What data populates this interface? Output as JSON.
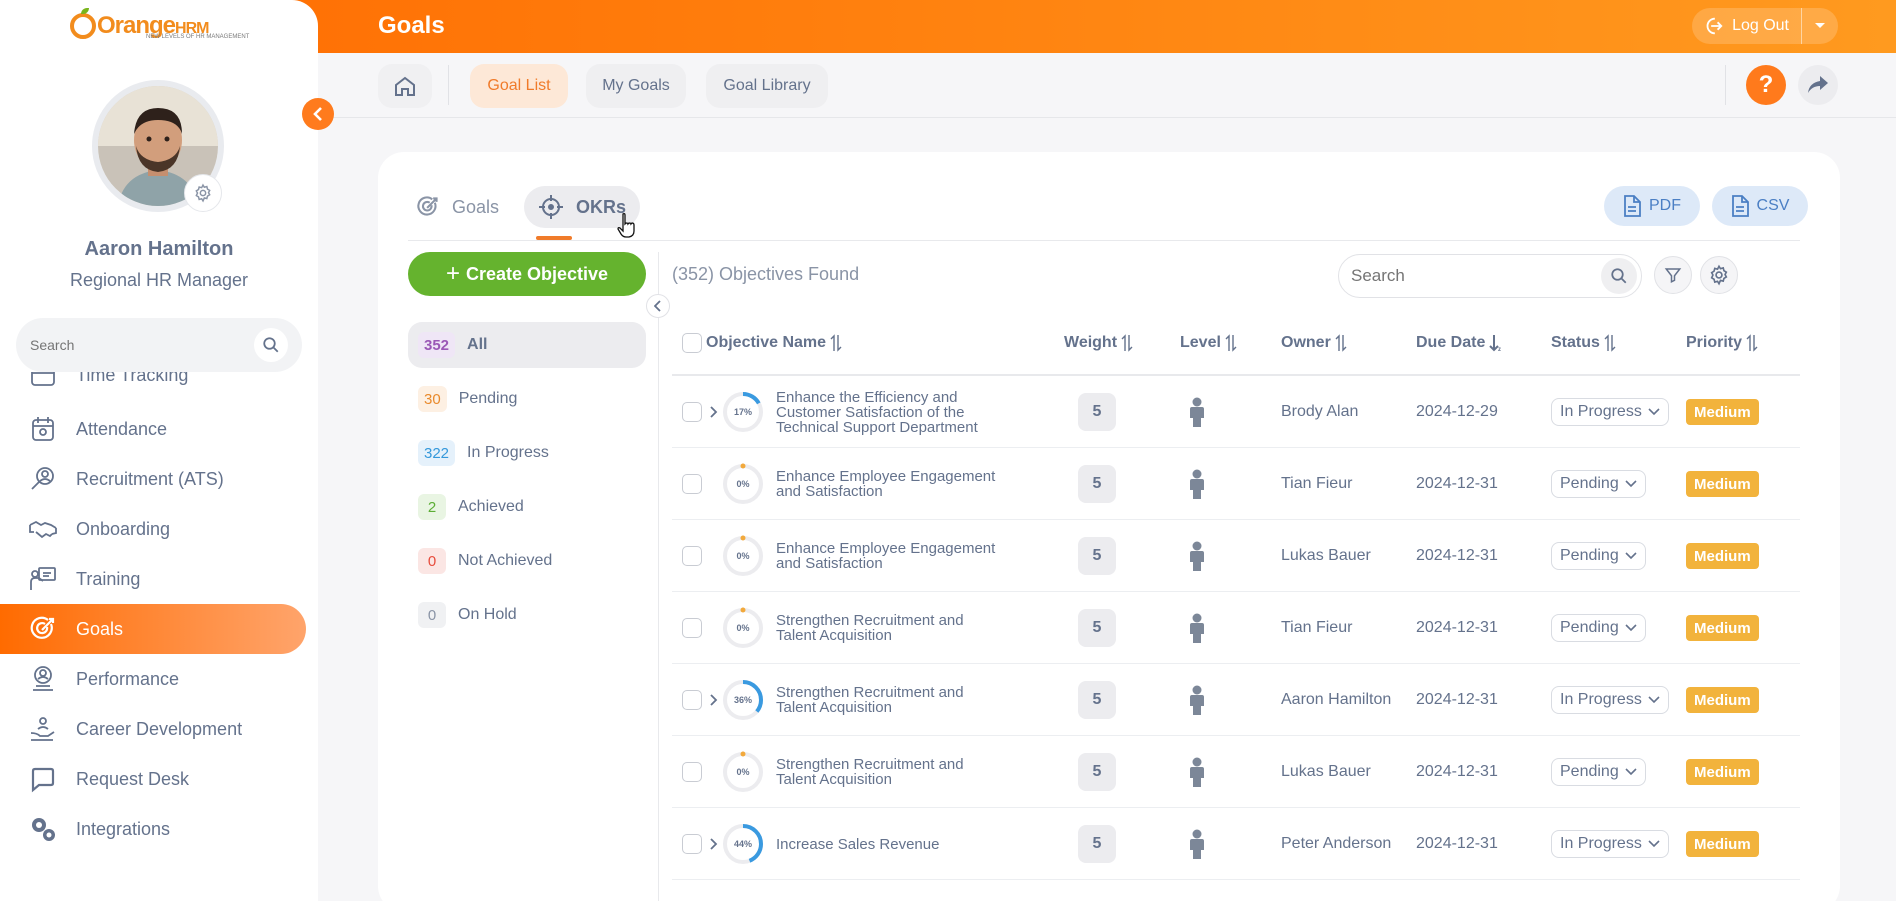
{
  "header": {
    "module_title": "Goals",
    "logout_label": "Log Out",
    "brand_color": "#ff7a1c"
  },
  "brand": {
    "logo_text": "Orange",
    "logo_text_suffix": "HRM",
    "tagline": "NEW LEVELS OF HR MANAGEMENT"
  },
  "user": {
    "name": "Aaron Hamilton",
    "role": "Regional HR Manager"
  },
  "sidebar": {
    "search_placeholder": "Search",
    "items": [
      {
        "label": "Time Tracking",
        "icon": "time-tracking-icon"
      },
      {
        "label": "Attendance",
        "icon": "attendance-icon"
      },
      {
        "label": "Recruitment (ATS)",
        "icon": "recruitment-icon"
      },
      {
        "label": "Onboarding",
        "icon": "onboarding-icon"
      },
      {
        "label": "Training",
        "icon": "training-icon"
      },
      {
        "label": "Goals",
        "icon": "goals-icon",
        "active": true
      },
      {
        "label": "Performance",
        "icon": "performance-icon"
      },
      {
        "label": "Career Development",
        "icon": "career-development-icon"
      },
      {
        "label": "Request Desk",
        "icon": "request-desk-icon"
      },
      {
        "label": "Integrations",
        "icon": "integrations-icon"
      }
    ]
  },
  "subnav": {
    "tabs": [
      {
        "label": "Goal List",
        "active": true
      },
      {
        "label": "My Goals"
      },
      {
        "label": "Goal Library"
      }
    ],
    "help_label": "?"
  },
  "view_tabs": {
    "goals_label": "Goals",
    "okrs_label": "OKRs",
    "active": "OKRs"
  },
  "export": {
    "pdf_label": "PDF",
    "csv_label": "CSV"
  },
  "actions": {
    "create_label": "Create Objective"
  },
  "summary": {
    "found_text": "(352) Objectives Found"
  },
  "table_search": {
    "placeholder": "Search"
  },
  "filters": [
    {
      "count": "352",
      "label": "All",
      "color": "#9b59b6",
      "bg": "#efe6f6",
      "active": true
    },
    {
      "count": "30",
      "label": "Pending",
      "color": "#e98a2c",
      "bg": "#fdf0e3"
    },
    {
      "count": "322",
      "label": "In Progress",
      "color": "#3498db",
      "bg": "#e5f1fb"
    },
    {
      "count": "2",
      "label": "Achieved",
      "color": "#5cae35",
      "bg": "#e9f5e3"
    },
    {
      "count": "0",
      "label": "Not Achieved",
      "color": "#e74c3c",
      "bg": "#fbe6e4"
    },
    {
      "count": "0",
      "label": "On Hold",
      "color": "#8a94a6",
      "bg": "#f0f1f3"
    }
  ],
  "table": {
    "columns": {
      "name": "Objective Name",
      "weight": "Weight",
      "level": "Level",
      "owner": "Owner",
      "due": "Due Date",
      "status": "Status",
      "priority": "Priority"
    },
    "rows": [
      {
        "progress": 17,
        "progress_label": "17%",
        "expandable": true,
        "name": "Enhance the Efficiency and Customer Satisfaction of the Technical Support Department",
        "weight": "5",
        "owner": "Brody Alan",
        "due": "2024-12-29",
        "status": "In Progress",
        "priority": "Medium"
      },
      {
        "progress": 0,
        "progress_label": "0%",
        "expandable": false,
        "name": "Enhance Employee Engagement and Satisfaction",
        "weight": "5",
        "owner": "Tian Fieur",
        "due": "2024-12-31",
        "status": "Pending",
        "priority": "Medium"
      },
      {
        "progress": 0,
        "progress_label": "0%",
        "expandable": false,
        "name": "Enhance Employee Engagement and Satisfaction",
        "weight": "5",
        "owner": "Lukas Bauer",
        "due": "2024-12-31",
        "status": "Pending",
        "priority": "Medium"
      },
      {
        "progress": 0,
        "progress_label": "0%",
        "expandable": false,
        "name": "Strengthen Recruitment and Talent Acquisition",
        "weight": "5",
        "owner": "Tian Fieur",
        "due": "2024-12-31",
        "status": "Pending",
        "priority": "Medium"
      },
      {
        "progress": 36,
        "progress_label": "36%",
        "expandable": true,
        "name": "Strengthen Recruitment and Talent Acquisition",
        "weight": "5",
        "owner": "Aaron Hamilton",
        "due": "2024-12-31",
        "status": "In Progress",
        "priority": "Medium"
      },
      {
        "progress": 0,
        "progress_label": "0%",
        "expandable": false,
        "name": "Strengthen Recruitment and Talent Acquisition",
        "weight": "5",
        "owner": "Lukas Bauer",
        "due": "2024-12-31",
        "status": "Pending",
        "priority": "Medium"
      },
      {
        "progress": 44,
        "progress_label": "44%",
        "expandable": true,
        "name": "Increase Sales Revenue",
        "weight": "5",
        "owner": "Peter Anderson",
        "due": "2024-12-31",
        "status": "In Progress",
        "priority": "Medium"
      }
    ]
  }
}
